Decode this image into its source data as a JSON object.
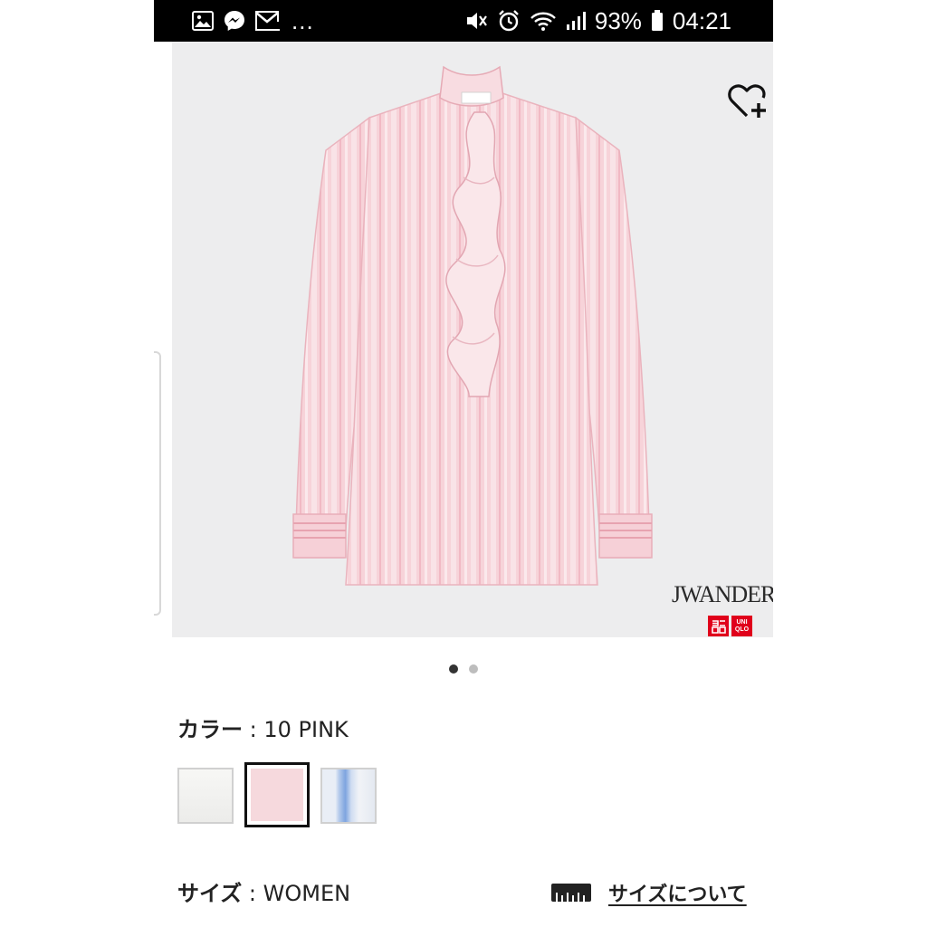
{
  "status_bar": {
    "battery": "93%",
    "time": "04:21",
    "more_indicator": "...",
    "left_icons": [
      "gallery-icon",
      "messenger-icon",
      "gmail-icon"
    ],
    "right_icons": [
      "mute-icon",
      "alarm-icon",
      "wifi-icon",
      "signal-icon",
      "battery-icon"
    ]
  },
  "product": {
    "image_description": "pink striped ruffle blouse",
    "brand_text": "JWANDERSO",
    "logo_top": "ユニ\nクロ",
    "logo_bottom": "UNI\nQLO",
    "wishlist_icon": "heart-plus-icon",
    "carousel": {
      "pages": 2,
      "active_index": 0
    }
  },
  "color": {
    "label": "カラー",
    "separator": " : ",
    "value": "10 PINK",
    "swatches": [
      {
        "name": "white",
        "selected": false
      },
      {
        "name": "pink",
        "selected": true
      },
      {
        "name": "blue-stripe",
        "selected": false
      }
    ]
  },
  "size": {
    "label": "サイズ",
    "separator": " : ",
    "value": "WOMEN",
    "guide_link": "サイズについて",
    "guide_icon": "ruler-icon"
  },
  "colors": {
    "accent_red": "#e0001b",
    "selected_border": "#111111",
    "image_bg": "#ededee"
  }
}
